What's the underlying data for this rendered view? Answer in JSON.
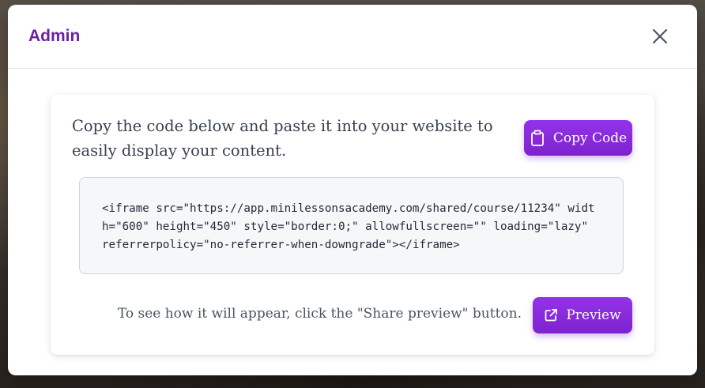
{
  "modal": {
    "title": "Admin",
    "close_icon": "close-icon"
  },
  "embed": {
    "instructions": "Copy the code below and paste it into your website to easily display your content.",
    "copy_button_label": "Copy Code",
    "copy_button_icon": "clipboard-icon",
    "code": "<iframe src=\"https://app.minilessonsacademy.com/shared/course/11234\" width=\"600\" height=\"450\" style=\"border:0;\" allowfullscreen=\"\" loading=\"lazy\" referrerpolicy=\"no-referrer-when-downgrade\"></iframe>",
    "preview_hint": "To see how it will appear, click the \"Share preview\" button.",
    "preview_button_label": "Preview",
    "preview_button_icon": "external-link-icon"
  },
  "colors": {
    "accent": "#9333ea",
    "title": "#6b21a8"
  }
}
